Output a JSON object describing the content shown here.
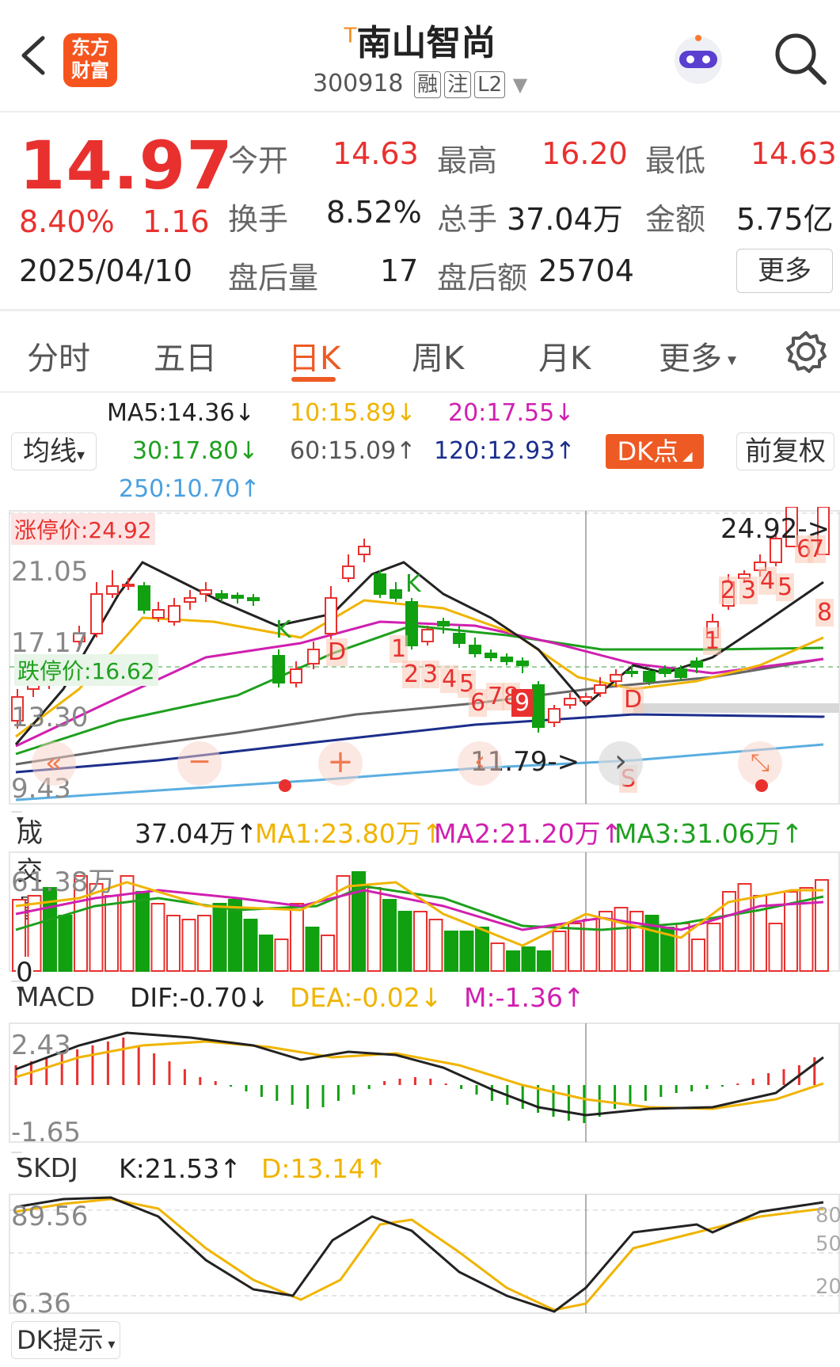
{
  "header": {
    "title": "南山智尚",
    "title_tag": "T",
    "code": "300918",
    "tags": [
      "融",
      "注",
      "L2"
    ],
    "logo_line1": "东方",
    "logo_line2": "财富"
  },
  "quote": {
    "price": "14.97",
    "change_pct": "8.40%",
    "change": "1.16",
    "date": "2025/04/10",
    "open_label": "今开",
    "open": "14.63",
    "high_label": "最高",
    "high": "16.20",
    "low_label": "最低",
    "low": "14.63",
    "turnover_label": "换手",
    "turnover": "8.52%",
    "volume_label": "总手",
    "volume": "37.04万",
    "amount_label": "金额",
    "amount": "5.75亿",
    "after_vol_label": "盘后量",
    "after_vol": "17",
    "after_amt_label": "盘后额",
    "after_amt": "25704",
    "more": "更多"
  },
  "tabs": [
    "分时",
    "五日",
    "日K",
    "周K",
    "月K",
    "更多"
  ],
  "active_tab": "日K",
  "ma": {
    "selector": "均线",
    "ma5": "MA5:14.36↓",
    "ma10": "10:15.89↓",
    "ma20": "20:17.55↓",
    "ma30": "30:17.80↓",
    "ma60": "60:15.09↑",
    "ma120": "120:12.93↑",
    "ma250": "250:10.70↑",
    "dk_button": "DK点",
    "adjust_button": "前复权"
  },
  "kline": {
    "limit_up": "涨停价:24.92",
    "limit_down": "跌停价:16.62",
    "y_labels": [
      "21.05",
      "17.17",
      "13.30",
      "9.43"
    ],
    "max_mark": "24.92->",
    "min_mark": "11.79->",
    "markers": [
      "K",
      "D",
      "K",
      "1",
      "2",
      "3",
      "4",
      "5",
      "6",
      "7",
      "8",
      "9",
      "D",
      "S",
      "1",
      "2",
      "3",
      "4",
      "5",
      "6",
      "7",
      "8"
    ]
  },
  "volume": {
    "selector": "成交量",
    "value": "37.04万↑",
    "ma1": "MA1:23.80万↑",
    "ma2": "MA2:21.20万↑",
    "ma3": "MA3:31.06万↑",
    "y_top": "61.38万",
    "y_bottom": "0"
  },
  "macd": {
    "selector": "MACD",
    "dif": "DIF:-0.70↓",
    "dea": "DEA:-0.02↓",
    "m": "M:-1.36↑",
    "y_top": "2.43",
    "y_bottom": "-1.65"
  },
  "skdj": {
    "selector": "SKDJ",
    "k": "K:21.53↑",
    "d": "D:13.14↑",
    "y_top": "89.56",
    "y_bottom": "6.36",
    "right_labels": [
      "80",
      "50",
      "20"
    ]
  },
  "footer": {
    "selector": "DK提示"
  },
  "colors": {
    "up": "#e8312f",
    "down": "#10a010",
    "accent": "#ee5a24",
    "ma5": "#222222",
    "ma10": "#f0b400",
    "ma20": "#d020b0",
    "ma30": "#1ea01e",
    "ma60": "#666666",
    "ma120": "#1c2e8c",
    "ma250": "#5aaee0"
  }
}
